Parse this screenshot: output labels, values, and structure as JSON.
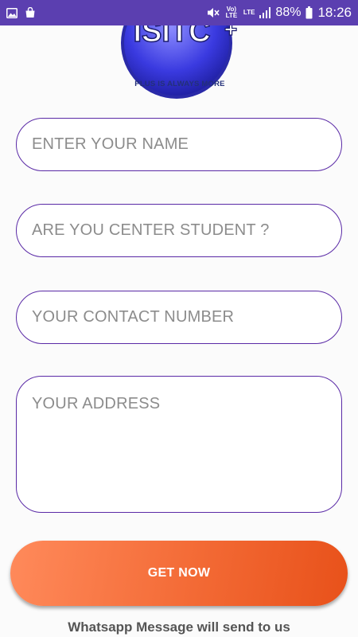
{
  "status_bar": {
    "left_icons": [
      "image-icon",
      "shopping-bag-icon"
    ],
    "right_icons": [
      "mute-icon",
      "volte-icon",
      "lte-icon",
      "signal-icon",
      "battery-icon"
    ],
    "volte_label": "Vo) LTE",
    "lte_label": "LTE",
    "battery_percent": "88%",
    "time": "18:26"
  },
  "logo": {
    "text": "ISITC",
    "tagline": "PLUS IS ALWAYS MORE"
  },
  "form": {
    "name_placeholder": "ENTER YOUR NAME",
    "student_placeholder": "ARE YOU CENTER STUDENT ?",
    "contact_placeholder": "YOUR CONTACT NUMBER",
    "address_placeholder": "YOUR ADDRESS",
    "submit_label": "GET NOW"
  },
  "footer": {
    "note": "Whatsapp Message will send to us"
  },
  "colors": {
    "status_bar": "#5b3fb0",
    "field_border": "#5a2aa6",
    "button_start": "#ff8a5b",
    "button_end": "#e8511a"
  }
}
